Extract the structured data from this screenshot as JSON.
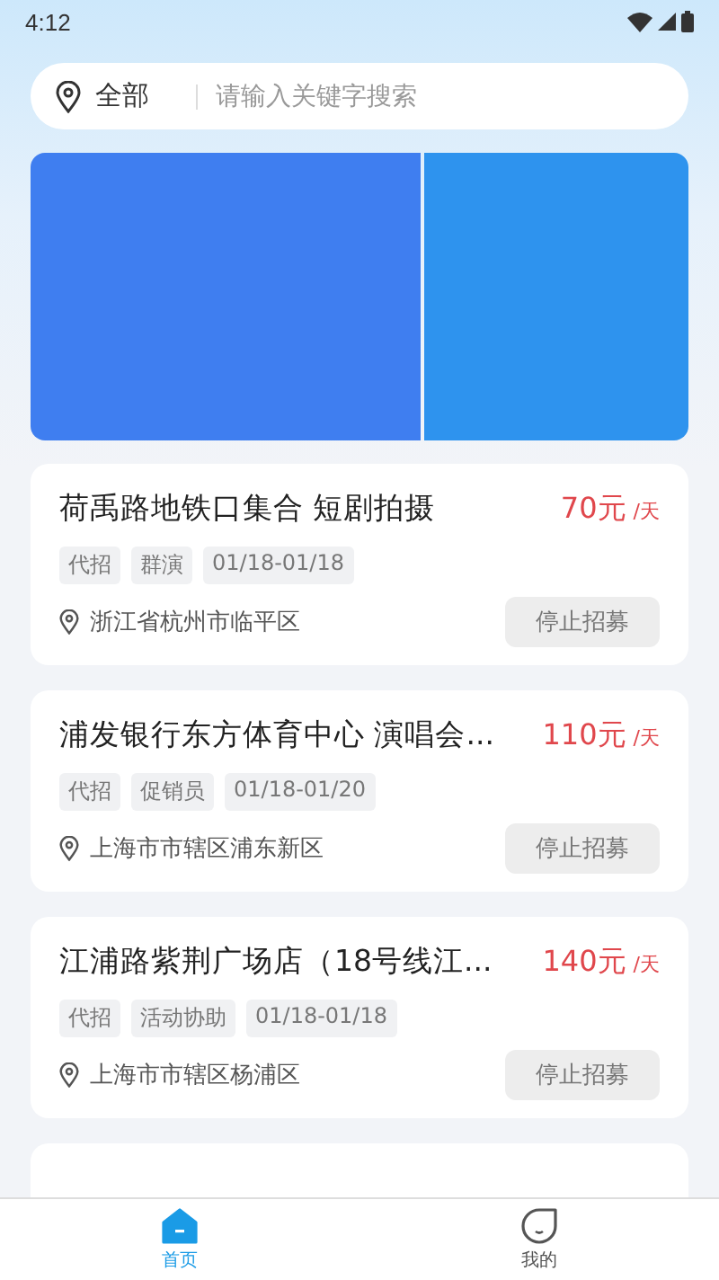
{
  "status_bar": {
    "time": "4:12"
  },
  "search": {
    "location": "全部",
    "placeholder": "请输入关键字搜索"
  },
  "banners": [
    {
      "kind": "main"
    },
    {
      "kind": "side"
    }
  ],
  "jobs": [
    {
      "title": "荷禹路地铁口集合 短剧拍摄",
      "price": "70元",
      "unit": "/天",
      "tags": [
        "代招",
        "群演",
        "01/18-01/18"
      ],
      "address": "浙江省杭州市临平区",
      "action": "停止招募"
    },
    {
      "title": "浦发银行东方体育中心 演唱会...",
      "price": "110元",
      "unit": "/天",
      "tags": [
        "代招",
        "促销员",
        "01/18-01/20"
      ],
      "address": "上海市市辖区浦东新区",
      "action": "停止招募"
    },
    {
      "title": "江浦路紫荆广场店（18号线江...",
      "price": "140元",
      "unit": "/天",
      "tags": [
        "代招",
        "活动协助",
        "01/18-01/18"
      ],
      "address": "上海市市辖区杨浦区",
      "action": "停止招募"
    }
  ],
  "tabs": [
    {
      "label": "首页",
      "kind": "home",
      "selected": true
    },
    {
      "label": "我的",
      "kind": "profile",
      "selected": false
    }
  ]
}
